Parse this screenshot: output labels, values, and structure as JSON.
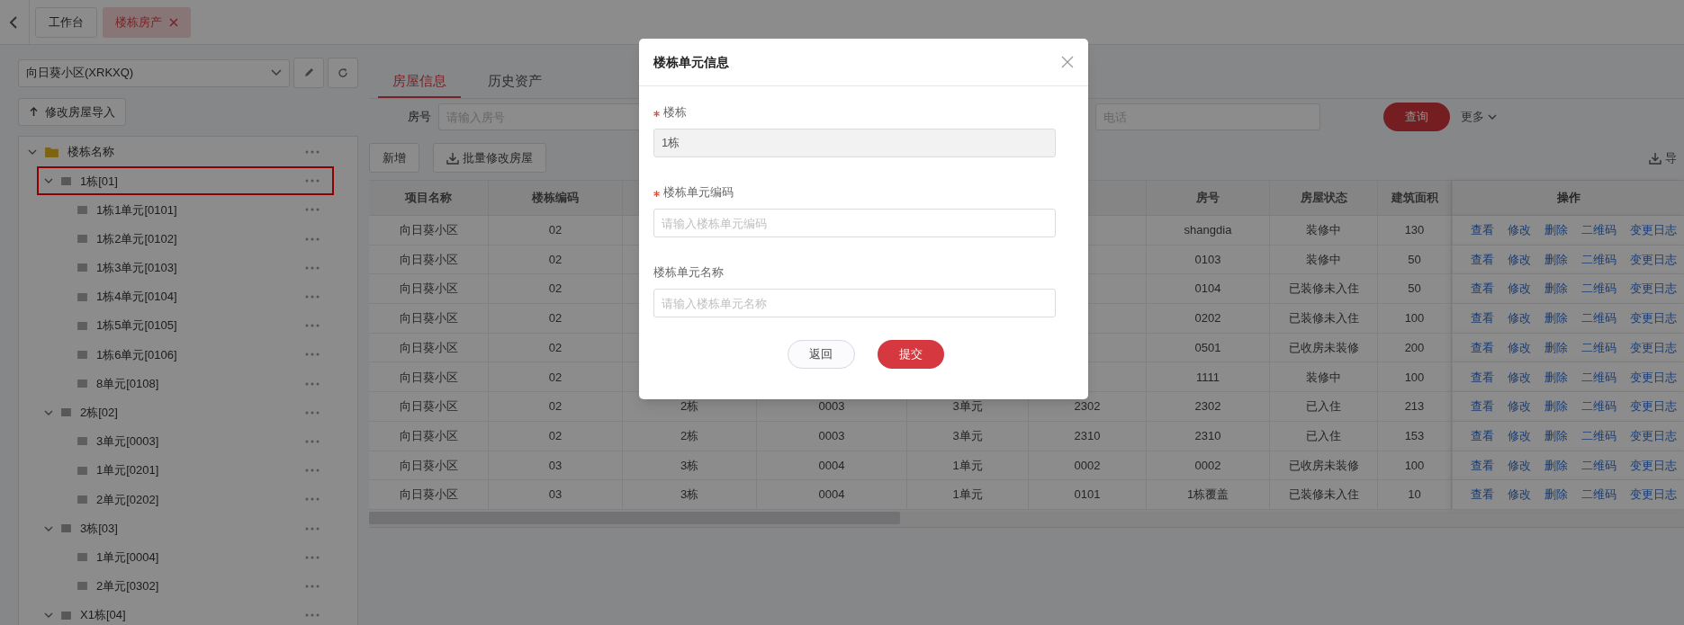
{
  "top_tabs": [
    {
      "label": "工作台",
      "selected": false,
      "closable": false
    },
    {
      "label": "楼栋房产",
      "selected": true,
      "closable": true
    }
  ],
  "left_panel": {
    "project_select": {
      "value": "向日葵小区(XRKXQ)"
    },
    "import_button": "修改房屋导入",
    "tree": [
      {
        "label": "楼栋名称",
        "kind": "folder",
        "expanded": true,
        "selected": false,
        "children": [
          {
            "label": "1栋[01]",
            "kind": "group",
            "expanded": true,
            "selected": true,
            "children": [
              {
                "label": "1栋1单元[0101]",
                "kind": "leaf",
                "selected": false
              },
              {
                "label": "1栋2单元[0102]",
                "kind": "leaf",
                "selected": false
              },
              {
                "label": "1栋3单元[0103]",
                "kind": "leaf",
                "selected": false
              },
              {
                "label": "1栋4单元[0104]",
                "kind": "leaf",
                "selected": false
              },
              {
                "label": "1栋5单元[0105]",
                "kind": "leaf",
                "selected": false
              },
              {
                "label": "1栋6单元[0106]",
                "kind": "leaf",
                "selected": false
              },
              {
                "label": "8单元[0108]",
                "kind": "leaf",
                "selected": false
              }
            ]
          },
          {
            "label": "2栋[02]",
            "kind": "group",
            "expanded": true,
            "selected": false,
            "children": [
              {
                "label": "3单元[0003]",
                "kind": "leaf",
                "selected": false
              },
              {
                "label": "1单元[0201]",
                "kind": "leaf",
                "selected": false
              },
              {
                "label": "2单元[0202]",
                "kind": "leaf",
                "selected": false
              }
            ]
          },
          {
            "label": "3栋[03]",
            "kind": "group",
            "expanded": true,
            "selected": false,
            "children": [
              {
                "label": "1单元[0004]",
                "kind": "leaf",
                "selected": false
              },
              {
                "label": "2单元[0302]",
                "kind": "leaf",
                "selected": false
              }
            ]
          },
          {
            "label": "X1栋[04]",
            "kind": "group",
            "expanded": true,
            "selected": false
          }
        ]
      }
    ]
  },
  "content_tabs": [
    {
      "label": "房屋信息",
      "selected": true
    },
    {
      "label": "历史资产",
      "selected": false
    }
  ],
  "filters": [
    {
      "label": "房号",
      "placeholder": "请输入房号"
    },
    {
      "placeholder": "电话"
    }
  ],
  "query_button": "查询",
  "more_toggle": {
    "label": "更多",
    "expanded": false
  },
  "toolbar": {
    "buttons": [
      {
        "label": "新增",
        "kind": "plain"
      },
      {
        "label": "批量修改房屋",
        "kind": "download"
      }
    ],
    "export": "导"
  },
  "table": {
    "columns": [
      "项目名称",
      "楼栋编码",
      null,
      null,
      null,
      null,
      "房号",
      "房屋状态",
      "建筑面积",
      "操作"
    ],
    "rows": [
      {
        "cells": [
          "向日葵小区",
          "02",
          null,
          null,
          null,
          null,
          "shangdia",
          "装修中",
          "130"
        ],
        "actions": [
          "查看",
          "修改",
          "删除",
          "二维码",
          "变更日志"
        ]
      },
      {
        "cells": [
          "向日葵小区",
          "02",
          null,
          null,
          null,
          null,
          "0103",
          "装修中",
          "50"
        ],
        "actions": [
          "查看",
          "修改",
          "删除",
          "二维码",
          "变更日志"
        ]
      },
      {
        "cells": [
          "向日葵小区",
          "02",
          null,
          null,
          null,
          null,
          "0104",
          "已装修未入住",
          "50"
        ],
        "actions": [
          "查看",
          "修改",
          "删除",
          "二维码",
          "变更日志"
        ]
      },
      {
        "cells": [
          "向日葵小区",
          "02",
          null,
          null,
          null,
          null,
          "0202",
          "已装修未入住",
          "100"
        ],
        "actions": [
          "查看",
          "修改",
          "删除",
          "二维码",
          "变更日志"
        ]
      },
      {
        "cells": [
          "向日葵小区",
          "02",
          null,
          null,
          null,
          null,
          "0501",
          "已收房未装修",
          "200"
        ],
        "actions": [
          "查看",
          "修改",
          "删除",
          "二维码",
          "变更日志"
        ]
      },
      {
        "cells": [
          "向日葵小区",
          "02",
          null,
          null,
          null,
          null,
          "1111",
          "装修中",
          "100"
        ],
        "actions": [
          "查看",
          "修改",
          "删除",
          "二维码",
          "变更日志"
        ]
      },
      {
        "cells": [
          "向日葵小区",
          "02",
          "2栋",
          "0003",
          "3单元",
          "2302",
          "2302",
          "已入住",
          "213"
        ],
        "actions": [
          "查看",
          "修改",
          "删除",
          "二维码",
          "变更日志"
        ]
      },
      {
        "cells": [
          "向日葵小区",
          "02",
          "2栋",
          "0003",
          "3单元",
          "2310",
          "2310",
          "已入住",
          "153"
        ],
        "actions": [
          "查看",
          "修改",
          "删除",
          "二维码",
          "变更日志"
        ]
      },
      {
        "cells": [
          "向日葵小区",
          "03",
          "3栋",
          "0004",
          "1单元",
          "0002",
          "0002",
          "已收房未装修",
          "100"
        ],
        "actions": [
          "查看",
          "修改",
          "删除",
          "二维码",
          "变更日志"
        ]
      },
      {
        "cells": [
          "向日葵小区",
          "03",
          "3栋",
          "0004",
          "1单元",
          "0101",
          "1栋覆盖",
          "已装修未入住",
          "10"
        ],
        "actions": [
          "查看",
          "修改",
          "删除",
          "二维码",
          "变更日志"
        ]
      }
    ]
  },
  "modal": {
    "title": "楼栋单元信息",
    "fields": [
      {
        "label": "楼栋",
        "required": true,
        "value": "1栋",
        "disabled": true
      },
      {
        "label": "楼栋单元编码",
        "required": true,
        "placeholder": "请输入楼栋单元编码",
        "disabled": false
      },
      {
        "label": "楼栋单元名称",
        "required": false,
        "placeholder": "请输入楼栋单元名称",
        "disabled": false
      }
    ],
    "buttons": [
      {
        "label": "返回",
        "kind": "secondary"
      },
      {
        "label": "提交",
        "kind": "primary"
      }
    ]
  }
}
